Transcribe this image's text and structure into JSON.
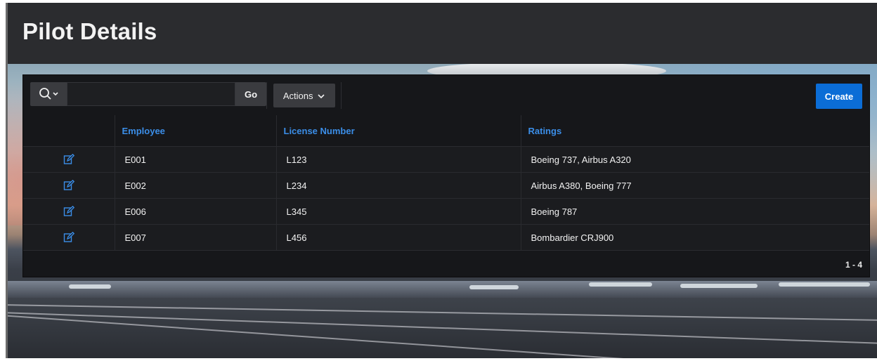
{
  "page": {
    "title": "Pilot Details"
  },
  "toolbar": {
    "search_icon": "search-icon",
    "search_value": "",
    "go_label": "Go",
    "actions_label": "Actions",
    "create_label": "Create"
  },
  "table": {
    "columns": [
      "Employee",
      "License Number",
      "Ratings"
    ],
    "rows": [
      {
        "employee": "E001",
        "license": "L123",
        "ratings": "Boeing 737, Airbus A320"
      },
      {
        "employee": "E002",
        "license": "L234",
        "ratings": "Airbus A380, Boeing 777"
      },
      {
        "employee": "E006",
        "license": "L345",
        "ratings": "Boeing 787"
      },
      {
        "employee": "E007",
        "license": "L456",
        "ratings": "Bombardier CRJ900"
      }
    ],
    "row_action_icon": "edit-icon"
  },
  "pagination": {
    "range": "1 - 4"
  },
  "colors": {
    "accent": "#0b6dd6",
    "header_link": "#3b8ee8",
    "region_bg": "#16171a"
  }
}
